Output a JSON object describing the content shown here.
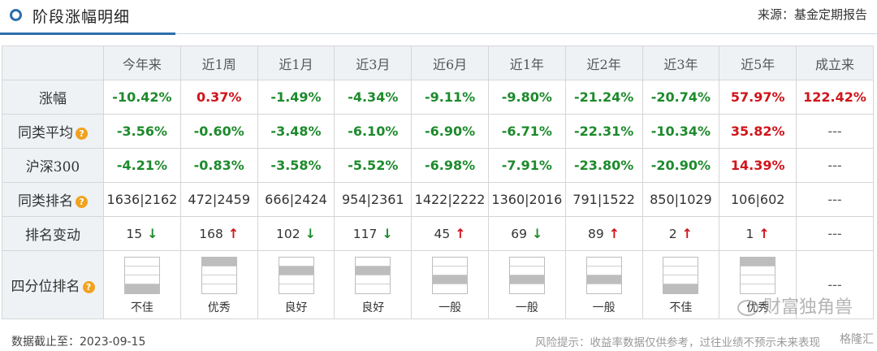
{
  "header": {
    "title": "阶段涨幅明细",
    "source": "来源：基金定期报告"
  },
  "table": {
    "columns": [
      "今年来",
      "近1周",
      "近1月",
      "近3月",
      "近6月",
      "近1年",
      "近2年",
      "近3年",
      "近5年",
      "成立来"
    ],
    "rows": {
      "change": {
        "label": "涨幅",
        "cells": [
          {
            "text": "-10.42%",
            "tone": "green"
          },
          {
            "text": "0.37%",
            "tone": "red"
          },
          {
            "text": "-1.49%",
            "tone": "green"
          },
          {
            "text": "-4.34%",
            "tone": "green"
          },
          {
            "text": "-9.11%",
            "tone": "green"
          },
          {
            "text": "-9.80%",
            "tone": "green"
          },
          {
            "text": "-21.24%",
            "tone": "green"
          },
          {
            "text": "-20.74%",
            "tone": "green"
          },
          {
            "text": "57.97%",
            "tone": "red"
          },
          {
            "text": "122.42%",
            "tone": "red"
          }
        ]
      },
      "peer_avg": {
        "label": "同类平均",
        "cells": [
          {
            "text": "-3.56%",
            "tone": "green"
          },
          {
            "text": "-0.60%",
            "tone": "green"
          },
          {
            "text": "-3.48%",
            "tone": "green"
          },
          {
            "text": "-6.10%",
            "tone": "green"
          },
          {
            "text": "-6.90%",
            "tone": "green"
          },
          {
            "text": "-6.71%",
            "tone": "green"
          },
          {
            "text": "-22.31%",
            "tone": "green"
          },
          {
            "text": "-10.34%",
            "tone": "green"
          },
          {
            "text": "35.82%",
            "tone": "red"
          },
          {
            "text": "---",
            "tone": "dash"
          }
        ]
      },
      "hs300": {
        "label": "沪深300",
        "cells": [
          {
            "text": "-4.21%",
            "tone": "green"
          },
          {
            "text": "-0.83%",
            "tone": "green"
          },
          {
            "text": "-3.58%",
            "tone": "green"
          },
          {
            "text": "-5.52%",
            "tone": "green"
          },
          {
            "text": "-6.98%",
            "tone": "green"
          },
          {
            "text": "-7.91%",
            "tone": "green"
          },
          {
            "text": "-23.80%",
            "tone": "green"
          },
          {
            "text": "-20.90%",
            "tone": "green"
          },
          {
            "text": "14.39%",
            "tone": "red"
          },
          {
            "text": "---",
            "tone": "dash"
          }
        ]
      },
      "peer_rank": {
        "label": "同类排名",
        "cells": [
          {
            "text": "1636|2162",
            "tone": "plain"
          },
          {
            "text": "472|2459",
            "tone": "plain"
          },
          {
            "text": "666|2424",
            "tone": "plain"
          },
          {
            "text": "954|2361",
            "tone": "plain"
          },
          {
            "text": "1422|2222",
            "tone": "plain"
          },
          {
            "text": "1360|2016",
            "tone": "plain"
          },
          {
            "text": "791|1522",
            "tone": "plain"
          },
          {
            "text": "850|1029",
            "tone": "plain"
          },
          {
            "text": "106|602",
            "tone": "plain"
          },
          {
            "text": "---",
            "tone": "dash"
          }
        ]
      },
      "rank_change": {
        "label": "排名变动",
        "cells": [
          {
            "text": "15",
            "dir": "down",
            "arrow": "↓"
          },
          {
            "text": "168",
            "dir": "up",
            "arrow": "↑"
          },
          {
            "text": "102",
            "dir": "down",
            "arrow": "↓"
          },
          {
            "text": "117",
            "dir": "down",
            "arrow": "↓"
          },
          {
            "text": "45",
            "dir": "up",
            "arrow": "↑"
          },
          {
            "text": "69",
            "dir": "down",
            "arrow": "↓"
          },
          {
            "text": "89",
            "dir": "up",
            "arrow": "↑"
          },
          {
            "text": "2",
            "dir": "up",
            "arrow": "↑"
          },
          {
            "text": "1",
            "dir": "up",
            "arrow": "↑"
          },
          {
            "text": "---",
            "dir": "none",
            "arrow": ""
          }
        ]
      },
      "quartile": {
        "label": "四分位排名",
        "cells": [
          {
            "label": "不佳",
            "level": 1
          },
          {
            "label": "优秀",
            "level": 4
          },
          {
            "label": "良好",
            "level": 3
          },
          {
            "label": "良好",
            "level": 3
          },
          {
            "label": "一般",
            "level": 2
          },
          {
            "label": "一般",
            "level": 2
          },
          {
            "label": "一般",
            "level": 2
          },
          {
            "label": "不佳",
            "level": 1
          },
          {
            "label": "优秀",
            "level": 4
          },
          {
            "label": "---",
            "level": 0
          }
        ]
      }
    },
    "help_icon": "question-icon"
  },
  "footer": {
    "date_label": "数据截止至：2023-09-15",
    "risk_notice": "风险提示：收益率数据仅供参考，过往业绩不预示未来表现",
    "watermark": "财富独角兽",
    "logo_text": "格隆汇"
  },
  "colors": {
    "accent": "#2d6eab",
    "positive": "#d0141a",
    "negative": "#1d8a2c",
    "header_bg": "#eef2f5",
    "help_icon": "#f0a21f"
  }
}
